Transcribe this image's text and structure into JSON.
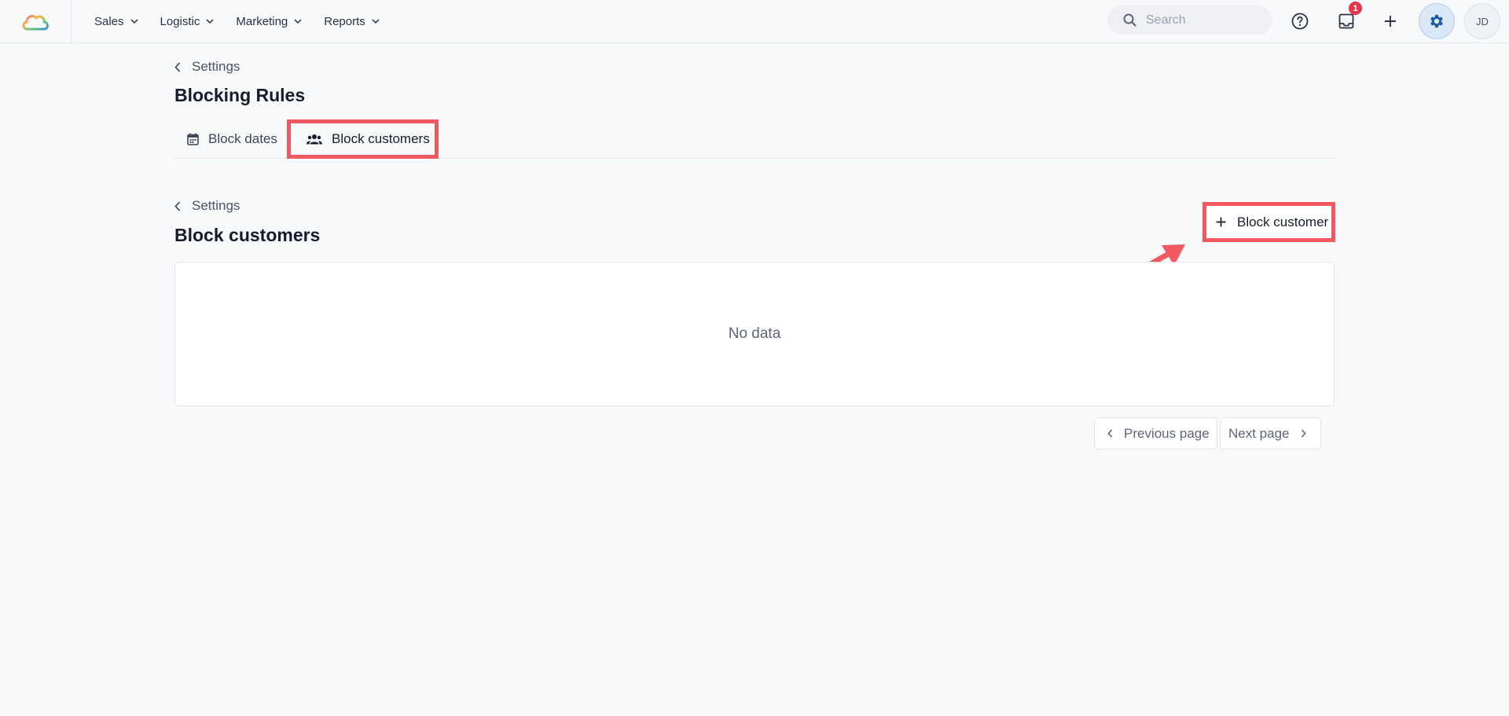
{
  "nav": {
    "items": [
      {
        "label": "Sales",
        "icon": "chevron-down-icon"
      },
      {
        "label": "Logistic",
        "icon": "chevron-down-icon"
      },
      {
        "label": "Marketing",
        "icon": "chevron-down-icon"
      },
      {
        "label": "Reports",
        "icon": "chevron-down-icon"
      }
    ],
    "search_placeholder": "Search",
    "notifications_count": "1",
    "avatar_initials": "JD",
    "icons": [
      "cloud-logo-icon",
      "search-icon",
      "help-icon",
      "inbox-icon",
      "plus-icon",
      "gear-icon"
    ]
  },
  "page": {
    "breadcrumb": "Settings",
    "title": "Blocking Rules",
    "tabs": [
      {
        "label": "Block dates",
        "icon": "calendar-icon",
        "active": false
      },
      {
        "label": "Block customers",
        "icon": "users-icon",
        "active": true
      }
    ]
  },
  "section": {
    "breadcrumb": "Settings",
    "title": "Block customers",
    "add_button": "Block customer",
    "empty_text": "No data",
    "prev_page": "Previous page",
    "next_page": "Next page"
  },
  "colors": {
    "annotation": "#f0595f",
    "badge": "#e5364c",
    "gear_active_bg": "#dbe8f7",
    "gear_icon": "#1d5c9e"
  }
}
